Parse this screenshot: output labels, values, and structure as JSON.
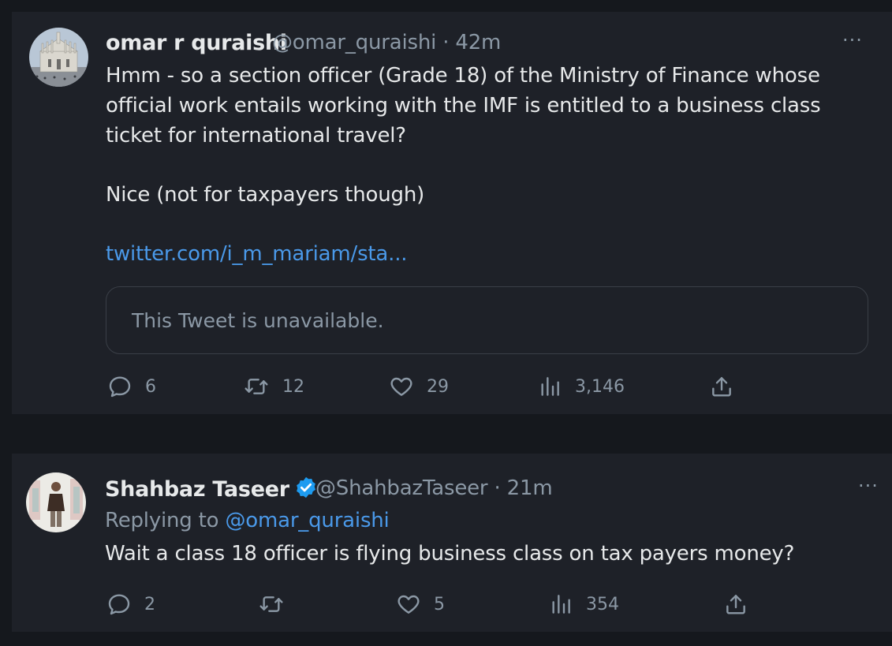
{
  "tweet1": {
    "display_name": "omar r quraishi",
    "handle": "@omar_quraishi",
    "time": "· 42m",
    "more": "···",
    "lines": [
      "Hmm - so a section officer (Grade 18) of the Ministry of Finance whose",
      "official work entails working with the IMF is entitled to a business class",
      "ticket for international travel?"
    ],
    "line2": "Nice (not for taxpayers though)",
    "link": "twitter.com/i_m_mariam/sta...",
    "quote_text": "This Tweet is unavailable.",
    "replies": "6",
    "retweets": "12",
    "likes": "29",
    "views": "3,146"
  },
  "tweet2": {
    "display_name": "Shahbaz Taseer",
    "handle": "@ShahbazTaseer",
    "time": "· 21m",
    "more": "···",
    "replying_prefix": "Replying to ",
    "replying_handle": "@omar_quraishi",
    "text": "Wait a class 18 officer is flying business class on tax payers money?",
    "replies": "2",
    "retweets": "",
    "likes": "5",
    "views": "354"
  },
  "colors": {
    "background": "#15181d",
    "card": "#1e2128",
    "text": "#e7e9ea",
    "muted": "#8b98a5",
    "link": "#4a99e9",
    "verified": "#1d9bf0"
  },
  "icons": {
    "reply": "reply-icon",
    "retweet": "retweet-icon",
    "like": "heart-icon",
    "views": "views-icon",
    "share": "share-icon",
    "verified": "verified-badge-icon"
  }
}
